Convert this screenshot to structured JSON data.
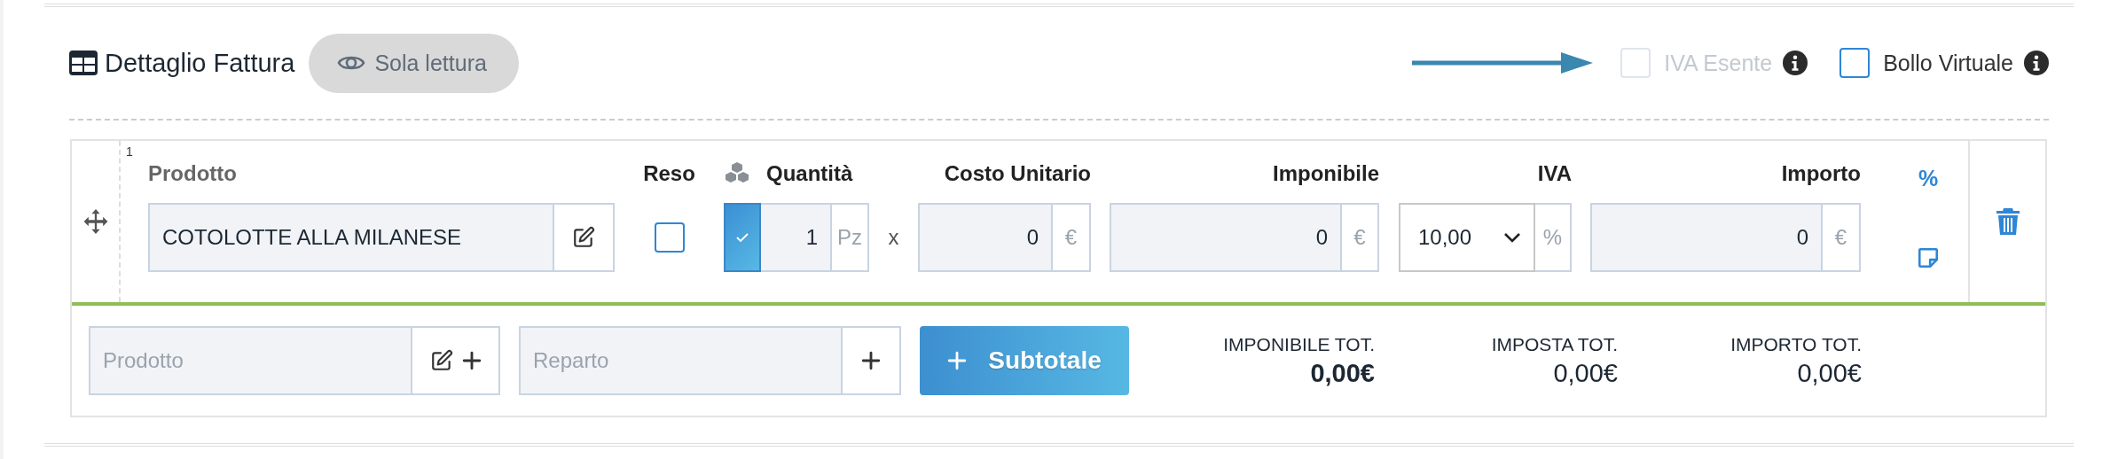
{
  "header": {
    "title": "Dettaglio Fattura",
    "badge": "Sola lettura"
  },
  "options": [
    {
      "label": "IVA Esente",
      "checked": false,
      "disabled": true
    },
    {
      "label": "Bollo Virtuale",
      "checked": false,
      "disabled": false
    }
  ],
  "rows": [
    {
      "number": "1",
      "product": {
        "label": "Prodotto",
        "value": "COTOLOTTE ALLA MILANESE"
      },
      "returned": {
        "label": "Reso",
        "checked": false
      },
      "quantity": {
        "label": "Quantità",
        "checked": true,
        "value": "1",
        "unit": "Pz"
      },
      "multiply": "x",
      "unit_cost": {
        "label": "Costo Unitario",
        "value": "0",
        "unit": "€"
      },
      "taxable": {
        "label": "Imponibile",
        "value": "0",
        "unit": "€"
      },
      "vat": {
        "label": "IVA",
        "value": "10,00",
        "unit": "%"
      },
      "amount": {
        "label": "Importo",
        "value": "0",
        "unit": "€"
      },
      "discount": "%"
    }
  ],
  "footer": {
    "product_placeholder": "Prodotto",
    "department_placeholder": "Reparto",
    "subtotal_button": "Subtotale",
    "totals": [
      {
        "label": "IMPONIBILE TOT.",
        "value": "0,00€",
        "emphasized": true
      },
      {
        "label": "IMPOSTA TOT.",
        "value": "0,00€",
        "emphasized": false
      },
      {
        "label": "IMPORTO TOT.",
        "value": "0,00€",
        "emphasized": false
      }
    ]
  }
}
